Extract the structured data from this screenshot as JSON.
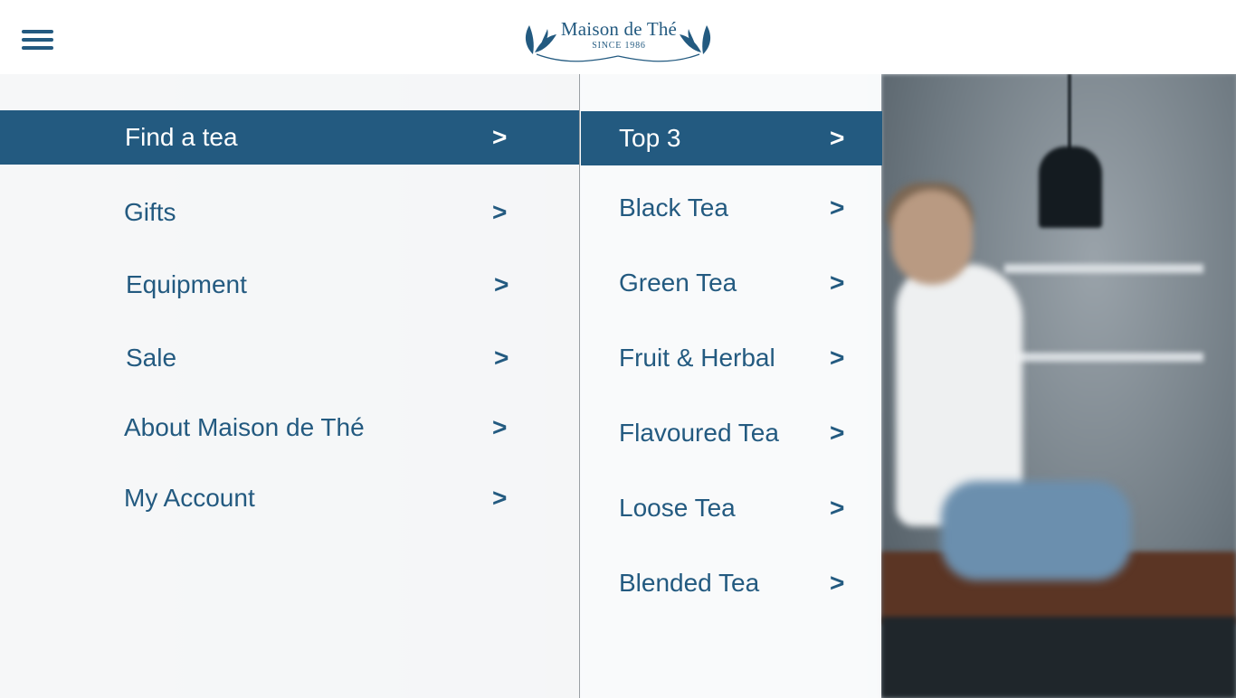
{
  "header": {
    "brand_name": "Maison de Thé",
    "brand_since": "SINCE 1986",
    "menu_icon": "hamburger-menu-icon"
  },
  "colors": {
    "brand": "#235a80",
    "active_bg": "#235a80",
    "active_text": "#ffffff"
  },
  "main_menu": {
    "items": [
      {
        "label": "Find a tea",
        "arrow": ">",
        "active": true
      },
      {
        "label": "Gifts",
        "arrow": ">"
      },
      {
        "label": "Equipment",
        "arrow": ">"
      },
      {
        "label": "Sale",
        "arrow": ">"
      },
      {
        "label": "About Maison de Thé",
        "arrow": ">"
      },
      {
        "label": "My Account",
        "arrow": ">"
      }
    ]
  },
  "sub_menu": {
    "items": [
      {
        "label": "Top 3",
        "arrow": ">",
        "active": true
      },
      {
        "label": "Black Tea",
        "arrow": ">"
      },
      {
        "label": "Green Tea",
        "arrow": ">"
      },
      {
        "label": "Fruit & Herbal",
        "arrow": ">"
      },
      {
        "label": "Flavoured Tea",
        "arrow": ">"
      },
      {
        "label": "Loose Tea",
        "arrow": ">"
      },
      {
        "label": "Blended Tea",
        "arrow": ">"
      }
    ]
  }
}
